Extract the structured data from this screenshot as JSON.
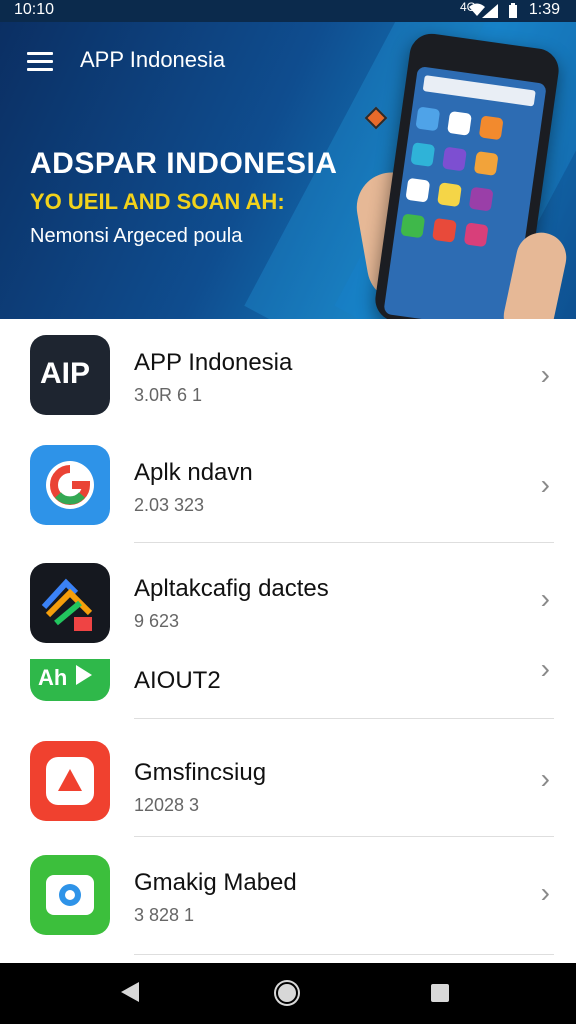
{
  "status_bar": {
    "time_left": "10:10",
    "signal_label": "4G",
    "time_right": "1:39"
  },
  "header": {
    "title": "APP Indonesia"
  },
  "banner": {
    "headline": "ADSPAR INDONESIA",
    "tagline": "YO UEIL AND SOAN AH:",
    "subline": "Nemonsi Argeced poula"
  },
  "apps": [
    {
      "name": "APP Indonesia",
      "version": "3.0R 6 1",
      "icon": "aip-logo-icon",
      "icon_text": "AIP"
    },
    {
      "name": "Aplk ndavn",
      "version": "2.03 323",
      "icon": "g-logo-icon"
    },
    {
      "name": "Apltakcafig dactes",
      "version": "9 623",
      "icon": "arrows-logo-icon"
    },
    {
      "name": "AIOUT2",
      "version": "",
      "icon": "green-play-icon",
      "icon_text": "Ah"
    },
    {
      "name": "Gmsfincsiug",
      "version": "12028 3",
      "icon": "red-triangle-icon"
    },
    {
      "name": "Gmakig Mabed",
      "version": "3 828 1",
      "icon": "green-camera-icon"
    }
  ],
  "colors": {
    "banner_dark": "#0b2f63",
    "banner_accent": "#1474b5",
    "tagline_yellow": "#f2d21b",
    "status_bar": "#0b2a4c"
  }
}
